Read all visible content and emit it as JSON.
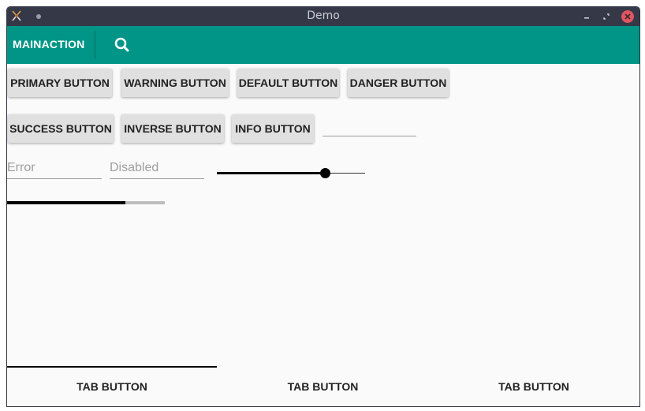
{
  "window": {
    "title": "Demo"
  },
  "toolbar": {
    "main_action": "MAINACTION",
    "search_icon": "search-icon"
  },
  "buttons": {
    "primary": "PRIMARY BUTTON",
    "warning": "WARNING BUTTON",
    "default": "DEFAULT BUTTON",
    "danger": "DANGER BUTTON",
    "success": "SUCCESS BUTTON",
    "inverse": "INVERSE BUTTON",
    "info": "INFO BUTTON"
  },
  "fields": {
    "text_value": "",
    "error_placeholder": "Error",
    "disabled_placeholder": "Disabled"
  },
  "slider": {
    "value_fraction": 0.73
  },
  "progress": {
    "value_fraction": 0.75
  },
  "tabs": [
    {
      "label": "TAB BUTTON",
      "selected": true
    },
    {
      "label": "TAB BUTTON",
      "selected": false
    },
    {
      "label": "TAB BUTTON",
      "selected": false
    }
  ],
  "colors": {
    "toolbar": "#009587",
    "titlebar": "#353847",
    "close": "#e05561"
  }
}
